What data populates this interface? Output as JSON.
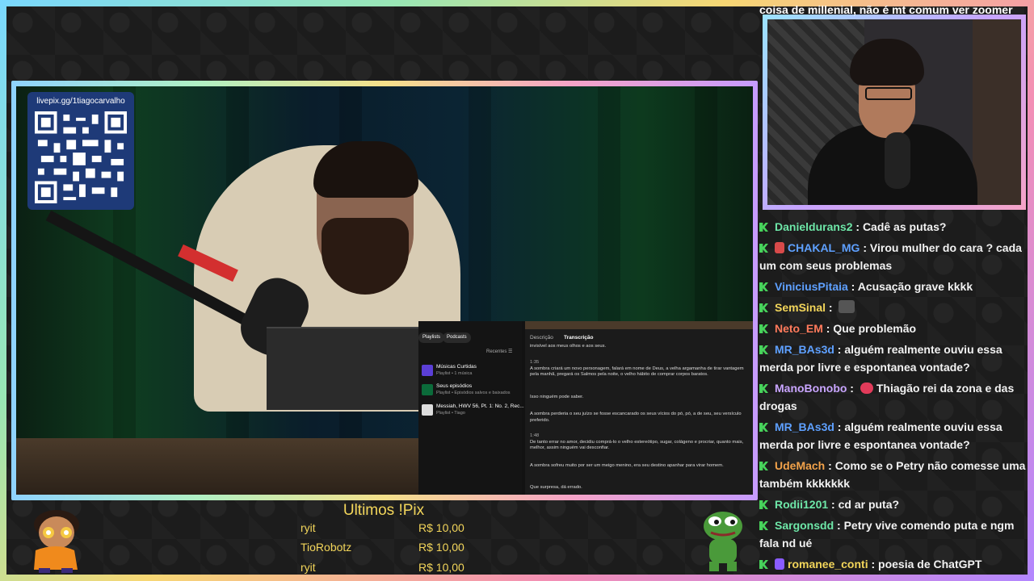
{
  "overlay": {
    "qr_url": "livepix.gg/1tiagocarvalho"
  },
  "pix": {
    "title": "Ultimos !Pix",
    "rows": [
      {
        "name": "ryit",
        "amount": "R$ 10,00"
      },
      {
        "name": "TioRobotz",
        "amount": "R$ 10,00"
      },
      {
        "name": "ryit",
        "amount": "R$ 10,00"
      }
    ]
  },
  "spotify": {
    "chips": [
      "Playlists",
      "Podcasts"
    ],
    "recent_label": "Recentes ☰",
    "items": [
      {
        "title": "Músicas Curtidas",
        "sub": "Playlist • 1 música",
        "color": "#5b3fd6"
      },
      {
        "title": "Seus episódios",
        "sub": "Playlist • Episódios salvos e baixados",
        "color": "#0b6b3a"
      },
      {
        "title": "Messiah, HWV 56, Pt. 1: No. 2, Rec...",
        "sub": "Playlist • Tiago",
        "color": "#ddd"
      }
    ],
    "tabs": [
      "Descrição",
      "Transcrição"
    ],
    "transcript": [
      {
        "time": "",
        "text": "invisível aos meus olhos e aos seus."
      },
      {
        "time": "1:35",
        "text": "A sombra criará um novo personagem, falará em nome de Deus, a velha argamanha de tirar vantagem pela manhã, pregará os Salmos pela noite, o velho hábito de comprar corpos baratos."
      },
      {
        "time": "",
        "text": "Isso ninguém pode saber."
      },
      {
        "time": "",
        "text": "A sombra perderia o seu juízo se fosse escancarado os seus vícios do pó, pó, a de seu, seu versículo preferido."
      },
      {
        "time": "1:48",
        "text": "De tanto errar no amor, decidiu comprá-lo o velho estereótipo, sugar, colágeno e procriar, quanto mais, melhor, assim ninguém vai desconfiar."
      },
      {
        "time": "",
        "text": "A sombra sofreu muito por ser um meigo menino, era seu destino apanhar para virar homem."
      },
      {
        "time": "",
        "text": "Que surpresa, dá errado."
      }
    ]
  },
  "chat": {
    "partial_top": "coisa de millenial, não é mt comum ver zoomer",
    "messages": [
      {
        "user": "Danieldurans2",
        "color": "#6ee7a8",
        "text": "Cadê as putas?",
        "emote": ""
      },
      {
        "user": "CHAKAL_MG",
        "color": "#5ea0ff",
        "text": "Virou mulher do cara ? cada um com seus problemas",
        "emote": "",
        "badge2": "#d84a4a"
      },
      {
        "user": "ViniciusPitaia",
        "color": "#5ea0ff",
        "text": "Acusação grave kkkk",
        "emote": ""
      },
      {
        "user": "SemSinal",
        "color": "#f2d55a",
        "text": "",
        "emote": "#555"
      },
      {
        "user": "Neto_EM",
        "color": "#ff7a5c",
        "text": "Que problemão",
        "emote": ""
      },
      {
        "user": "MR_BAs3d",
        "color": "#5ea0ff",
        "text": "alguém realmente ouviu essa merda por livre e espontanea vontade?",
        "emote": ""
      },
      {
        "user": "ManoBonobo",
        "color": "#c9a5ff",
        "text": "Thiagão rei da zona e das drogas",
        "emote": "#e23b5a"
      },
      {
        "user": "MR_BAs3d",
        "color": "#5ea0ff",
        "text": "alguém realmente ouviu essa merda por livre e espontanea vontade?",
        "emote": ""
      },
      {
        "user": "UdeMach",
        "color": "#f2a24a",
        "text": "Como se o Petry não comesse uma também kkkkkkk",
        "emote": ""
      },
      {
        "user": "Rodii1201",
        "color": "#6ee7a8",
        "text": "cd ar puta?",
        "emote": ""
      },
      {
        "user": "Sargonsdd",
        "color": "#6ee7a8",
        "text": "Petry vive comendo puta e ngm fala nd ué",
        "emote": ""
      },
      {
        "user": "romanee_conti",
        "color": "#f2d55a",
        "text": "poesia de ChatGPT",
        "emote": "",
        "badge2": "#8a5cff"
      }
    ]
  }
}
